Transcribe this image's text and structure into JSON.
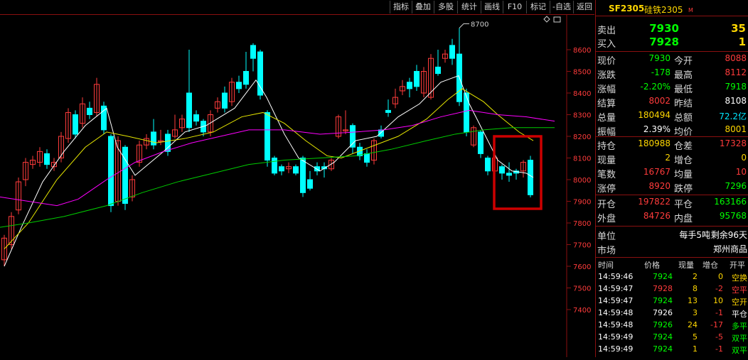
{
  "toolbar": {
    "buttons": [
      "指标",
      "叠加",
      "多股",
      "统计",
      "画线",
      "F10",
      "标记",
      "-自选",
      "返回"
    ]
  },
  "chart": {
    "peak_label": "8700",
    "y_ticks": [
      "8600",
      "8500",
      "8400",
      "8300",
      "8200",
      "8100",
      "8000",
      "7900",
      "7800",
      "7700",
      "7600",
      "7500",
      "7400"
    ],
    "colors": {
      "up": "#ff3b3b",
      "down": "#00ffff",
      "ma_white": "#ffffff",
      "ma_yellow": "#e6e600",
      "ma_magenta": "#ff00ff",
      "ma_green": "#00cc00",
      "highlight": "#cc0000"
    }
  },
  "quote": {
    "symbol": "SF2305",
    "name": "硅铁2305",
    "flag": "M",
    "sell_label": "卖出",
    "sell_price": "7930",
    "sell_qty": "35",
    "buy_label": "买入",
    "buy_price": "7928",
    "buy_qty": "1",
    "rows1": [
      {
        "l1": "现价",
        "v1": "7930",
        "c1": "green",
        "l2": "今开",
        "v2": "8088",
        "c2": "red"
      },
      {
        "l1": "涨跌",
        "v1": "-178",
        "c1": "green",
        "l2": "最高",
        "v2": "8112",
        "c2": "red"
      },
      {
        "l1": "涨幅",
        "v1": "-2.20%",
        "c1": "green",
        "l2": "最低",
        "v2": "7918",
        "c2": "green"
      },
      {
        "l1": "结算",
        "v1": "8002",
        "c1": "red",
        "l2": "昨结",
        "v2": "8108",
        "c2": "white"
      },
      {
        "l1": "总量",
        "v1": "180494",
        "c1": "yellow",
        "l2": "总额",
        "v2": "72.2亿",
        "c2": "cyan"
      },
      {
        "l1": "振幅",
        "v1": "2.39%",
        "c1": "white",
        "l2": "均价",
        "v2": "8001",
        "c2": "yellow"
      }
    ],
    "rows2": [
      {
        "l1": "持仓",
        "v1": "180988",
        "c1": "yellow",
        "l2": "仓差",
        "v2": "17328",
        "c2": "red"
      },
      {
        "l1": "现量",
        "v1": "2",
        "c1": "yellow",
        "l2": "增仓",
        "v2": "0",
        "c2": "yellow"
      },
      {
        "l1": "笔数",
        "v1": "16767",
        "c1": "red",
        "l2": "均量",
        "v2": "10",
        "c2": "red"
      },
      {
        "l1": "涨停",
        "v1": "8920",
        "c1": "red",
        "l2": "跌停",
        "v2": "7296",
        "c2": "green"
      }
    ],
    "rows3": [
      {
        "l1": "开仓",
        "v1": "197822",
        "c1": "red",
        "l2": "平仓",
        "v2": "163166",
        "c2": "green"
      },
      {
        "l1": "外盘",
        "v1": "84726",
        "c1": "red",
        "l2": "内盘",
        "v2": "95768",
        "c2": "green"
      }
    ],
    "unit_label": "单位",
    "unit_value": "每手5吨",
    "remain_label": "剩余96天",
    "market_label": "市场",
    "market_value": "郑州商品"
  },
  "trades": {
    "headers": [
      "时间",
      "价格",
      "现量",
      "增仓",
      "开平"
    ],
    "rows": [
      {
        "time": "14:59:46",
        "price": "7924",
        "qty": "2",
        "oi": "0",
        "type": "空换",
        "tc": "green",
        "oc": "yellow"
      },
      {
        "time": "14:59:47",
        "price": "7928",
        "qty": "8",
        "oi": "-2",
        "type": "空平",
        "tc": "red",
        "oc": "red"
      },
      {
        "time": "14:59:47",
        "price": "7924",
        "qty": "13",
        "oi": "10",
        "type": "空开",
        "tc": "green",
        "oc": "yellow"
      },
      {
        "time": "14:59:48",
        "price": "7926",
        "qty": "3",
        "oi": "-1",
        "type": "平仓",
        "tc": "white",
        "oc": "white"
      },
      {
        "time": "14:59:48",
        "price": "7926",
        "qty": "24",
        "oi": "-17",
        "type": "多平",
        "tc": "green",
        "oc": "green"
      },
      {
        "time": "14:59:49",
        "price": "7924",
        "qty": "5",
        "oi": "-5",
        "type": "双平",
        "tc": "green",
        "oc": "green"
      },
      {
        "time": "14:59:49",
        "price": "7924",
        "qty": "1",
        "oi": "-1",
        "type": "双平",
        "tc": "green",
        "oc": "green"
      }
    ]
  }
}
